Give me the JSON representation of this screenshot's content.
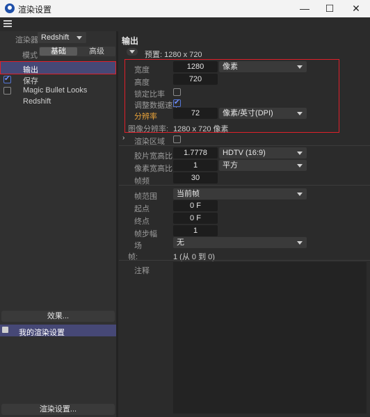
{
  "window": {
    "title": "渲染设置",
    "minimize": "—",
    "maximize": "☐",
    "close": "✕"
  },
  "left": {
    "renderer_label": "渲染器",
    "renderer_value": "Redshift",
    "mode_label": "模式",
    "mode_tabs": [
      "基础",
      "高级"
    ],
    "items": [
      {
        "label": "输出",
        "checked": false,
        "selected": true
      },
      {
        "label": "保存",
        "checked": true
      },
      {
        "label": "Magic Bullet Looks",
        "checked": false
      },
      {
        "label": "Redshift",
        "checked": false
      }
    ],
    "effects_button": "效果...",
    "setting_item": "我的渲染设置",
    "render_settings_button": "渲染设置..."
  },
  "output": {
    "section_title": "输出",
    "preset_label": "预置: 1280 x 720",
    "width_label": "宽度",
    "width_value": "1280",
    "width_unit": "像素",
    "height_label": "高度",
    "height_value": "720",
    "lock_ratio_label": "锁定比率",
    "adjust_rate_label": "调整数据速率",
    "resolution_label": "分辨率",
    "resolution_value": "72",
    "resolution_unit": "像素/英寸(DPI)",
    "image_res_label": "图像分辨率:",
    "image_res_value": "1280 x 720 像素",
    "render_region_label": "渲染区域",
    "film_aspect_label": "胶片宽高比",
    "film_aspect_value": "1.7778",
    "film_aspect_preset": "HDTV (16:9)",
    "pixel_aspect_label": "像素宽高比",
    "pixel_aspect_value": "1",
    "pixel_aspect_preset": "平方",
    "fps_label": "帧频",
    "fps_value": "30",
    "frame_range_label": "帧范围",
    "frame_range_value": "当前帧",
    "start_label": "起点",
    "start_value": "0 F",
    "end_label": "终点",
    "end_value": "0 F",
    "step_label": "帧步幅",
    "step_value": "1",
    "field_label": "场",
    "field_value": "无",
    "frames_label": "帧:",
    "frames_value": "1 (从 0 到 0)",
    "notes_label": "注释"
  },
  "colors": {
    "accent": "#5a6cd6",
    "highlight_orange": "#e8a23a",
    "annotation_red": "#e0202a"
  }
}
